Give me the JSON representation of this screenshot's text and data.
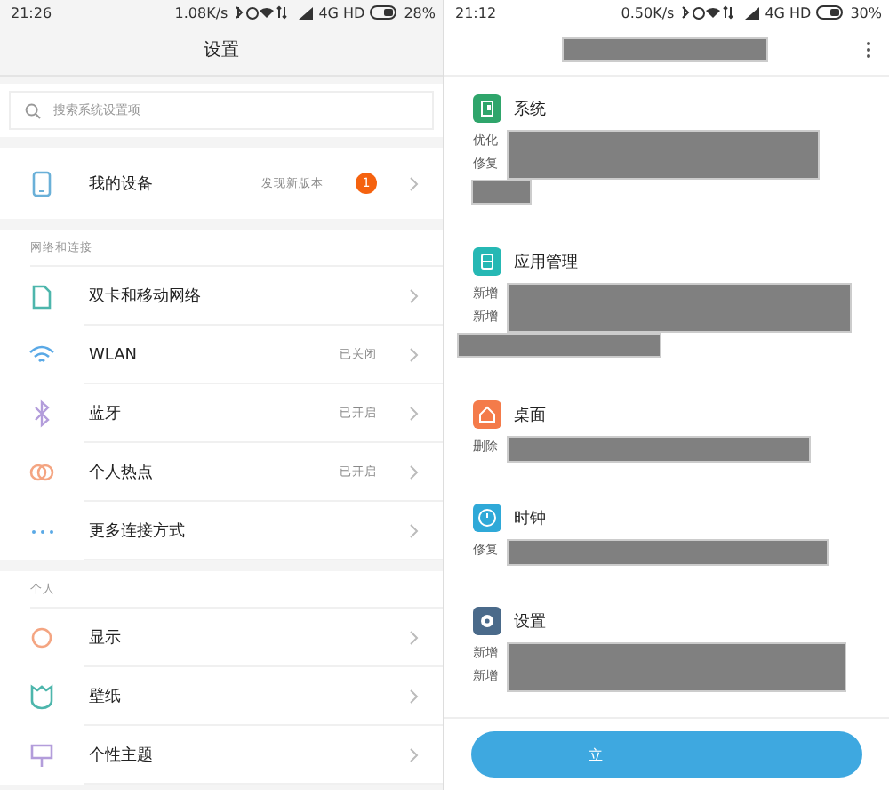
{
  "left_screen": {
    "status_bar": {
      "time": "21:26",
      "speed": "1.08K/s",
      "network": "4G HD",
      "battery": "28%"
    },
    "title": "设置",
    "search": {
      "placeholder": "搜索系统设置项"
    },
    "groups": [
      {
        "items": [
          {
            "label": "我的设备",
            "value": "发现新版本",
            "badge": "1"
          }
        ]
      },
      {
        "header": "网络和连接",
        "items": [
          {
            "label": "双卡和移动网络"
          },
          {
            "label": "WLAN",
            "value": "已关闭"
          },
          {
            "label": "蓝牙",
            "value": "已开启"
          },
          {
            "label": "个人热点",
            "value": "已开启"
          },
          {
            "label": "更多连接方式"
          }
        ]
      },
      {
        "header": "个人",
        "items": [
          {
            "label": "显示"
          },
          {
            "label": "壁纸"
          },
          {
            "label": "个性主题"
          }
        ]
      }
    ]
  },
  "right_screen": {
    "status_bar": {
      "time": "21:12",
      "speed": "0.50K/s",
      "network": "4G HD",
      "battery": "30%"
    },
    "sections": [
      {
        "color": "#2fa56b",
        "title": "系统",
        "lines": [
          "优化",
          "修复"
        ]
      },
      {
        "color": "#26b8b4",
        "title": "应用管理",
        "lines": [
          "新增",
          "新增"
        ]
      },
      {
        "color": "#f47b4a",
        "title": "桌面",
        "lines": [
          "删除"
        ]
      },
      {
        "color": "#2fa9d8",
        "title": "时钟",
        "lines": [
          "修复"
        ]
      },
      {
        "color": "#4a6a8a",
        "title": "设置",
        "lines": [
          "新增",
          "新增"
        ]
      }
    ],
    "button": {
      "label": "立"
    }
  }
}
